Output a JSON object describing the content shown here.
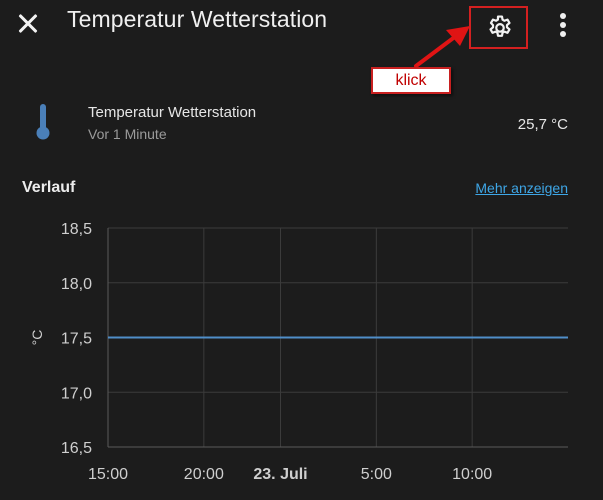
{
  "header": {
    "title": "Temperatur Wetterstation",
    "close_icon": "close-icon",
    "settings_icon": "gear-icon",
    "more_icon": "more-vertical-icon"
  },
  "annotation": {
    "note": "klick",
    "arrow_color": "#e01414",
    "highlight_color": "#d42020"
  },
  "entity": {
    "icon": "thermometer-icon",
    "name": "Temperatur Wetterstation",
    "last_changed": "Vor 1 Minute",
    "state": "25,7 °C"
  },
  "history": {
    "title": "Verlauf",
    "more_link": "Mehr anzeigen"
  },
  "colors": {
    "background": "#1c1c1c",
    "accent_link": "#3ea6e6",
    "line": "#4f8ec9",
    "icon_blue": "#4a7fb8"
  },
  "chart_data": {
    "type": "line",
    "ylabel": "°C",
    "xlabel": "",
    "ylim": [
      16.5,
      18.5
    ],
    "y_ticks": [
      "18,5",
      "18,0",
      "17,5",
      "17,0",
      "16,5"
    ],
    "x_ticks": [
      {
        "label": "15:00",
        "t": 0,
        "bold": false
      },
      {
        "label": "20:00",
        "t": 5,
        "bold": false
      },
      {
        "label": "23. Juli",
        "t": 9,
        "bold": true
      },
      {
        "label": "5:00",
        "t": 14,
        "bold": false
      },
      {
        "label": "10:00",
        "t": 19,
        "bold": false
      }
    ],
    "xlim": [
      0,
      24
    ],
    "series": [
      {
        "x": [
          0,
          24
        ],
        "values": [
          17.5,
          17.5
        ]
      }
    ],
    "grid": true
  }
}
